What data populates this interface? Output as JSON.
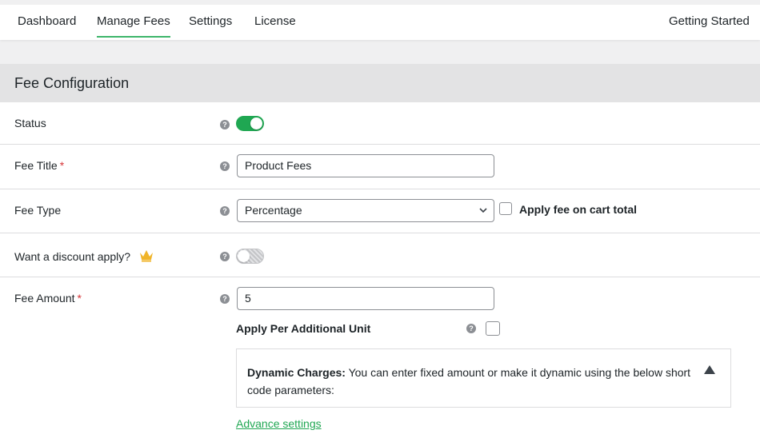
{
  "nav": {
    "items": [
      {
        "label": "Dashboard"
      },
      {
        "label": "Manage Fees",
        "active": true
      },
      {
        "label": "Settings"
      },
      {
        "label": "License"
      }
    ],
    "getting_started": "Getting Started",
    "accent_color": "#3db56a"
  },
  "panel": {
    "title": "Fee Configuration"
  },
  "form": {
    "status": {
      "label": "Status",
      "enabled": true
    },
    "fee_title": {
      "label": "Fee Title",
      "required_mark": "*",
      "value": "Product Fees"
    },
    "fee_type": {
      "label": "Fee Type",
      "value": "Percentage",
      "apply_cart_total_label": "Apply fee on cart total",
      "apply_cart_total_checked": false
    },
    "discount": {
      "label": "Want a discount apply?",
      "enabled": false,
      "pro_icon": "crown-icon"
    },
    "fee_amount": {
      "label": "Fee Amount",
      "required_mark": "*",
      "value": "5"
    },
    "per_unit": {
      "label": "Apply Per Additional Unit",
      "checked": false
    },
    "dynamic": {
      "heading": "Dynamic Charges:",
      "text": " You can enter fixed amount or make it dynamic using the below short code parameters:"
    },
    "advance_link": "Advance settings",
    "help_icon": "question-circle-icon"
  },
  "colors": {
    "toggle_on": "#1fa752",
    "required": "#d63638",
    "link": "#1fa752"
  }
}
